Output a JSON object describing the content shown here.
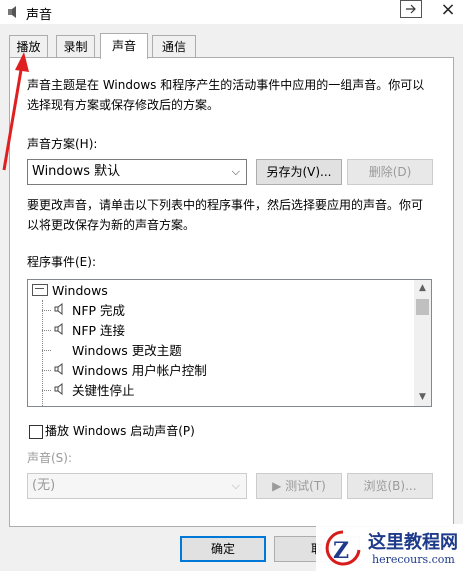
{
  "window": {
    "title": "声音",
    "close_glyph": "×"
  },
  "tabs": [
    {
      "label": "播放"
    },
    {
      "label": "录制"
    },
    {
      "label": "声音",
      "active": true
    },
    {
      "label": "通信"
    }
  ],
  "intro_text": "声音主题是在 Windows 和程序产生的活动事件中应用的一组声音。你可以选择现有方案或保存修改后的方案。",
  "scheme": {
    "label": "声音方案(H):",
    "selected": "Windows 默认",
    "save_as_label": "另存为(V)...",
    "delete_label": "删除(D)"
  },
  "instructions_text": "要更改声音，请单击以下列表中的程序事件，然后选择要应用的声音。你可以将更改保存为新的声音方案。",
  "events": {
    "label": "程序事件(E):",
    "items": [
      {
        "text": "Windows",
        "level": 0,
        "has_sound": false
      },
      {
        "text": "NFP 完成",
        "level": 1,
        "has_sound": true
      },
      {
        "text": "NFP 连接",
        "level": 1,
        "has_sound": true
      },
      {
        "text": "Windows 更改主题",
        "level": 1,
        "has_sound": false
      },
      {
        "text": "Windows 用户帐户控制",
        "level": 1,
        "has_sound": true
      },
      {
        "text": "关键性停止",
        "level": 1,
        "has_sound": true
      }
    ]
  },
  "startup_checkbox": {
    "label": "播放 Windows 启动声音(P)",
    "checked": false
  },
  "sound": {
    "label": "声音(S):",
    "selected": "(无)",
    "test_label": "▶ 测试(T)",
    "browse_label": "浏览(B)..."
  },
  "footer": {
    "ok_label": "确定",
    "cancel_label": "取"
  },
  "watermark": {
    "title": "这里教程网",
    "subtitle": "herecours.com"
  },
  "colors": {
    "accent": "#0078d7",
    "annotation_arrow": "#e02020",
    "watermark": "#1e3a8a"
  }
}
